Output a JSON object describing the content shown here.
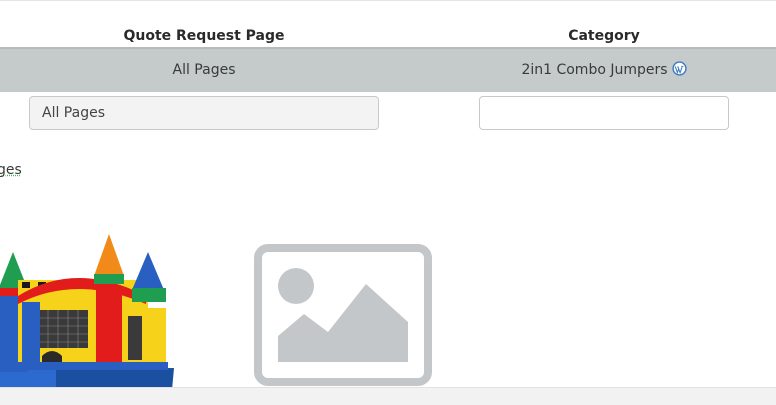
{
  "table": {
    "headers": {
      "quote_request_page": "Quote Request Page",
      "category": "Category"
    },
    "row": {
      "quote_request_page": "All Pages",
      "category": "2in1 Combo Jumpers"
    }
  },
  "inputs": {
    "quote_request_page_value": "All Pages",
    "category_value": ""
  },
  "link": {
    "text": "ges"
  },
  "images": {
    "product_image_icon": "bounce-house-castle",
    "placeholder_icon": "image-placeholder-icon"
  },
  "colors": {
    "row_background": "#c5cbcb",
    "placeholder_gray": "#c4c7c9",
    "wordpress_blue": "#3d7ac0"
  }
}
